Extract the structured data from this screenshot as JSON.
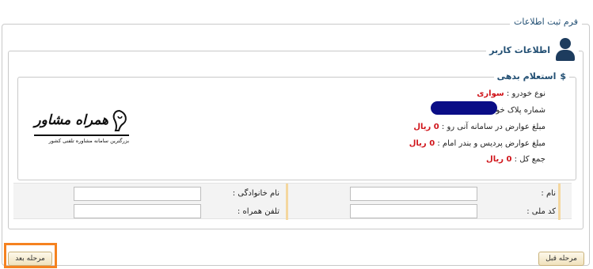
{
  "form": {
    "title": "فرم ثبت اطلاعات"
  },
  "user_section": {
    "title": "اطلاعات کاربر",
    "icon": "user-icon"
  },
  "debt_section": {
    "title": "استعلام بدهی",
    "icon_glyph": "$",
    "rows": [
      {
        "label": "نوع خودرو :",
        "value": "سواری"
      },
      {
        "label": "شماره پلاک خودرو :",
        "value": ""
      },
      {
        "label": "مبلغ عوارض در سامانه آنی رو :",
        "value": "0 ریال"
      },
      {
        "label": "مبلغ عوارض پردیس و بندر امام :",
        "value": "0 ریال"
      },
      {
        "label": "جمع کل :",
        "value": "0 ریال"
      }
    ],
    "plate_redaction_color": "#0a0d86"
  },
  "logo": {
    "brand": "همراه مشاور",
    "tagline": "بزرگترین سامانه مشاوره تلفنی کشور"
  },
  "fields": {
    "first_name": {
      "label": "نام :",
      "value": ""
    },
    "last_name": {
      "label": "نام خانوادگی :",
      "value": ""
    },
    "national_code": {
      "label": "کد ملی :",
      "value": ""
    },
    "mobile": {
      "label": "تلفن همراه :",
      "value": ""
    }
  },
  "buttons": {
    "prev": "مرحله قبل",
    "next": "مرحله بعد"
  },
  "colors": {
    "accent": "#224f73",
    "value_red": "#d0141a",
    "highlight": "#f58220",
    "separator": "#f4d79f"
  }
}
